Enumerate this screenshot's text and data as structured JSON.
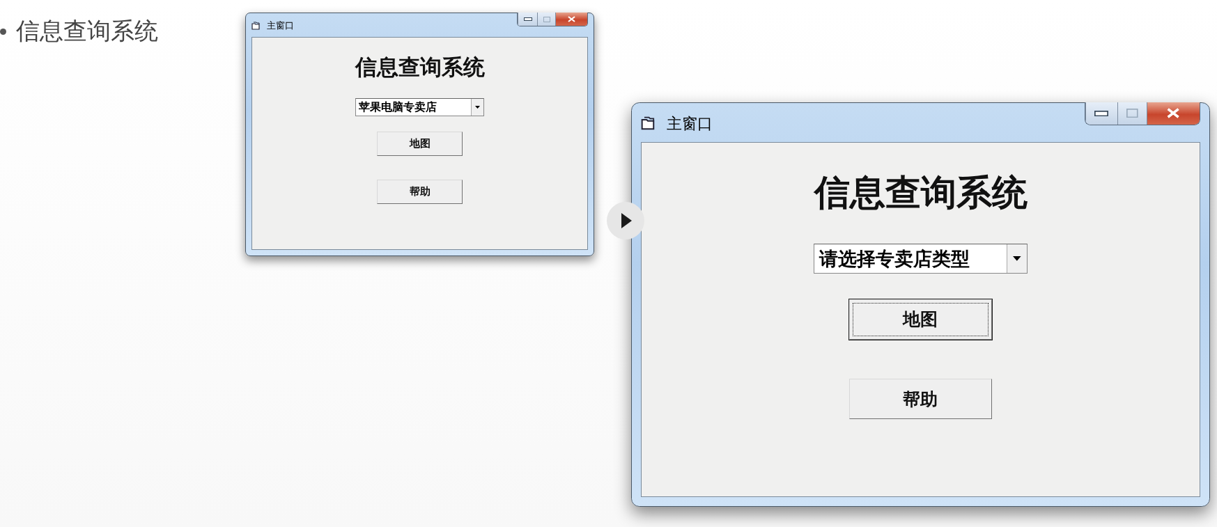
{
  "slide": {
    "bullet": "信息查询系统"
  },
  "windows": [
    {
      "title": "主窗口",
      "heading": "信息查询系统",
      "combo": {
        "value": "苹果电脑专卖店"
      },
      "buttons": [
        {
          "label": "地图",
          "focused": false
        },
        {
          "label": "帮助",
          "focused": false
        }
      ]
    },
    {
      "title": "主窗口",
      "heading": "信息查询系统",
      "combo": {
        "value": "请选择专卖店类型"
      },
      "buttons": [
        {
          "label": "地图",
          "focused": true
        },
        {
          "label": "帮助",
          "focused": false
        }
      ]
    }
  ]
}
